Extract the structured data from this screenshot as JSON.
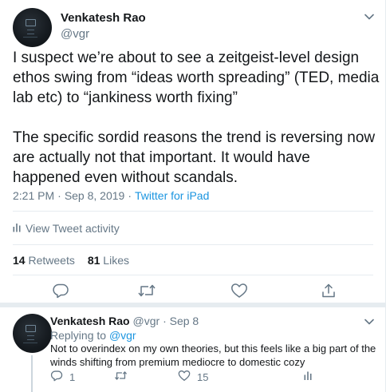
{
  "colors": {
    "text": "#14171a",
    "secondary": "#657786",
    "link": "#1b95e0",
    "border": "#e6ecf0"
  },
  "main_tweet": {
    "author_name": "Venkatesh Rao",
    "author_handle": "@vgr",
    "text": "I suspect we’re about to see a zeitgeist-level design ethos swing from “ideas worth spreading” (TED, media lab etc) to “jankiness worth fixing”\n\nThe specific sordid reasons the trend is reversing now are actually not that important. It would have happened even without scandals.",
    "time": "2:21 PM",
    "date": "Sep 8, 2019",
    "source": "Twitter for iPad",
    "activity_label": "View Tweet activity",
    "retweet_count": "14",
    "retweet_label": "Retweets",
    "like_count": "81",
    "like_label": "Likes",
    "icons": {
      "more": "chevron-down-icon",
      "reply": "reply-icon",
      "retweet": "retweet-icon",
      "like": "heart-icon",
      "share": "share-icon",
      "analytics": "analytics-icon"
    }
  },
  "reply_tweet": {
    "author_name": "Venkatesh Rao",
    "author_handle": "@vgr",
    "date": "Sep 8",
    "replying_label": "Replying to",
    "replying_to": "@vgr",
    "text": "Not to overindex on my own theories, but this feels like a big part of the winds shifting from premium mediocre to domestic cozy",
    "reply_count": "1",
    "like_count": "15"
  }
}
